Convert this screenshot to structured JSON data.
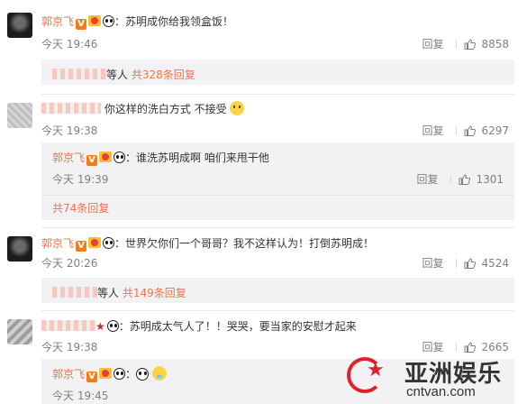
{
  "actions": {
    "reply_label": "回复"
  },
  "comments": [
    {
      "user": "郭京飞",
      "text": "：苏明成你给我领盒饭！",
      "time": "今天 19:46",
      "likes": "8858",
      "replies_summary": {
        "suffix": "等人",
        "more": "共328条回复"
      }
    },
    {
      "text": "你这样的洗白方式 不接受",
      "time": "今天 19:38",
      "likes": "6297",
      "reply": {
        "user": "郭京飞",
        "text": "：谁洗苏明成啊 咱们来甩干他",
        "time": "今天 19:39",
        "likes": "1301"
      },
      "more": "共74条回复"
    },
    {
      "user": "郭京飞",
      "text": "：世界欠你们一个哥哥？我不这样认为！打倒苏明成！",
      "time": "今天 20:26",
      "likes": "4524",
      "replies_summary": {
        "suffix": "等人",
        "more": "共149条回复"
      }
    },
    {
      "text": "：苏明成太气人了！！哭哭，要当家的安慰才起来",
      "time": "今天 19:38",
      "likes": "2665",
      "reply": {
        "user": "郭京飞",
        "text": "：",
        "time": "今天 19:45"
      }
    }
  ],
  "watermark": {
    "title": "亚洲娱乐",
    "url": "cntvan.com"
  },
  "colors": {
    "username": "#eb7350",
    "muted": "#808080",
    "box": "#f2f2f5",
    "accent": "#e0202a"
  },
  "icons": [
    "verified-v-badge",
    "vip-crown-badge",
    "panda-emoji",
    "like-thumb-icon",
    "sleepy-emoji"
  ]
}
